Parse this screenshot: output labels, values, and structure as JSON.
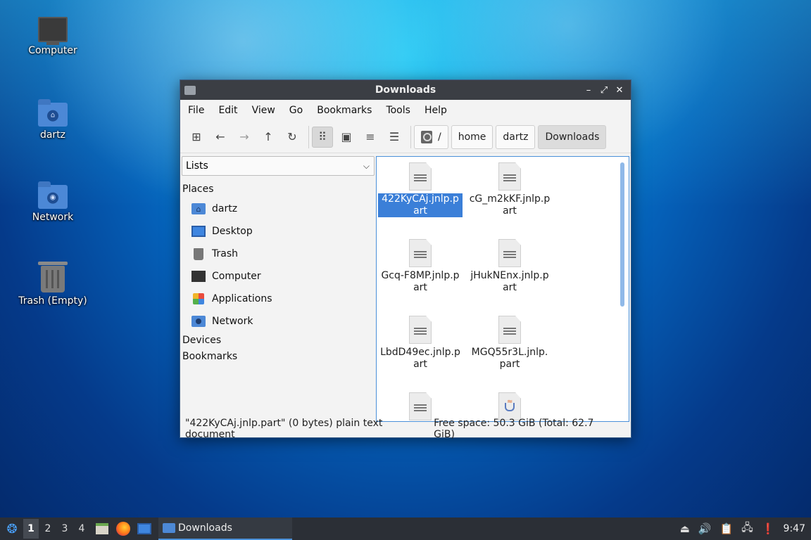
{
  "desktop": {
    "icons": [
      {
        "label": "Computer"
      },
      {
        "label": "dartz"
      },
      {
        "label": "Network"
      },
      {
        "label": "Trash (Empty)"
      }
    ]
  },
  "window": {
    "title": "Downloads",
    "controls": {
      "minimize": "–",
      "maximize": "⤢",
      "close": "✕"
    },
    "menu": [
      "File",
      "Edit",
      "View",
      "Go",
      "Bookmarks",
      "Tools",
      "Help"
    ],
    "toolbar": {
      "new_window_icon": "⊞",
      "back_icon": "←",
      "forward_icon": "→",
      "up_icon": "↑",
      "reload_icon": "↻",
      "icon_view_icon": "⠿",
      "compact_view_icon": "▣",
      "detail_view_icon": "≡",
      "list_view_icon": "☰"
    },
    "breadcrumb": [
      "/",
      "home",
      "dartz",
      "Downloads"
    ],
    "sidebar": {
      "selector": "Lists",
      "sections": {
        "places": "Places",
        "devices": "Devices",
        "bookmarks": "Bookmarks"
      },
      "places": [
        {
          "label": "dartz",
          "icon": "home-folder-icon"
        },
        {
          "label": "Desktop",
          "icon": "desktop-icon"
        },
        {
          "label": "Trash",
          "icon": "trash-icon"
        },
        {
          "label": "Computer",
          "icon": "computer-icon"
        },
        {
          "label": "Applications",
          "icon": "applications-icon"
        },
        {
          "label": "Network",
          "icon": "network-icon"
        }
      ]
    },
    "files": [
      {
        "name": "422KyCAj.jnlp.part",
        "selected": true
      },
      {
        "name": "cG_m2kKF.jnlp.part",
        "selected": false
      },
      {
        "name": "Gcq-F8MP.jnlp.part",
        "selected": false
      },
      {
        "name": "jHukNEnx.jnlp.part",
        "selected": false
      },
      {
        "name": "LbdD49ec.jnlp.part",
        "selected": false
      },
      {
        "name": "MGQ55r3L.jnlp.part",
        "selected": false
      }
    ],
    "status": {
      "selection": "\"422KyCAj.jnlp.part\" (0 bytes) plain text document",
      "free_space": "Free space: 50.3 GiB (Total: 62.7 GiB)"
    }
  },
  "taskbar": {
    "workspaces": [
      "1",
      "2",
      "3",
      "4"
    ],
    "current_workspace": "1",
    "task_label": "Downloads",
    "clock": "9:47"
  }
}
